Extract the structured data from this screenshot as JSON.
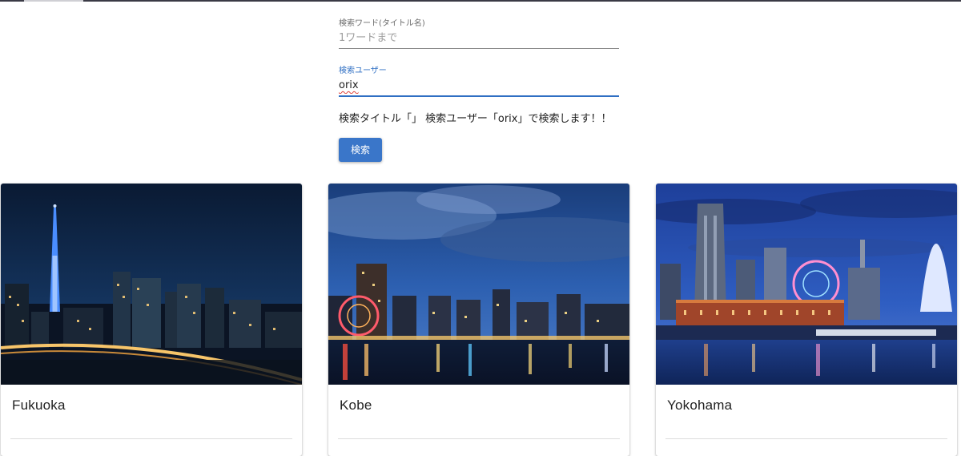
{
  "search_form": {
    "title_field": {
      "label": "検索ワード(タイトル名)",
      "value": "",
      "placeholder": "1ワードまで"
    },
    "user_field": {
      "label": "検索ユーザー",
      "value": "orix",
      "placeholder": ""
    },
    "status_text": "検索タイトル「」 検索ユーザー「orix」で検索します！！",
    "search_button_label": "検索"
  },
  "cards": [
    {
      "title": "Fukuoka"
    },
    {
      "title": "Kobe"
    },
    {
      "title": "Yokohama"
    }
  ],
  "colors": {
    "accent": "#3a76c9",
    "active_label": "#2f6fc3"
  }
}
